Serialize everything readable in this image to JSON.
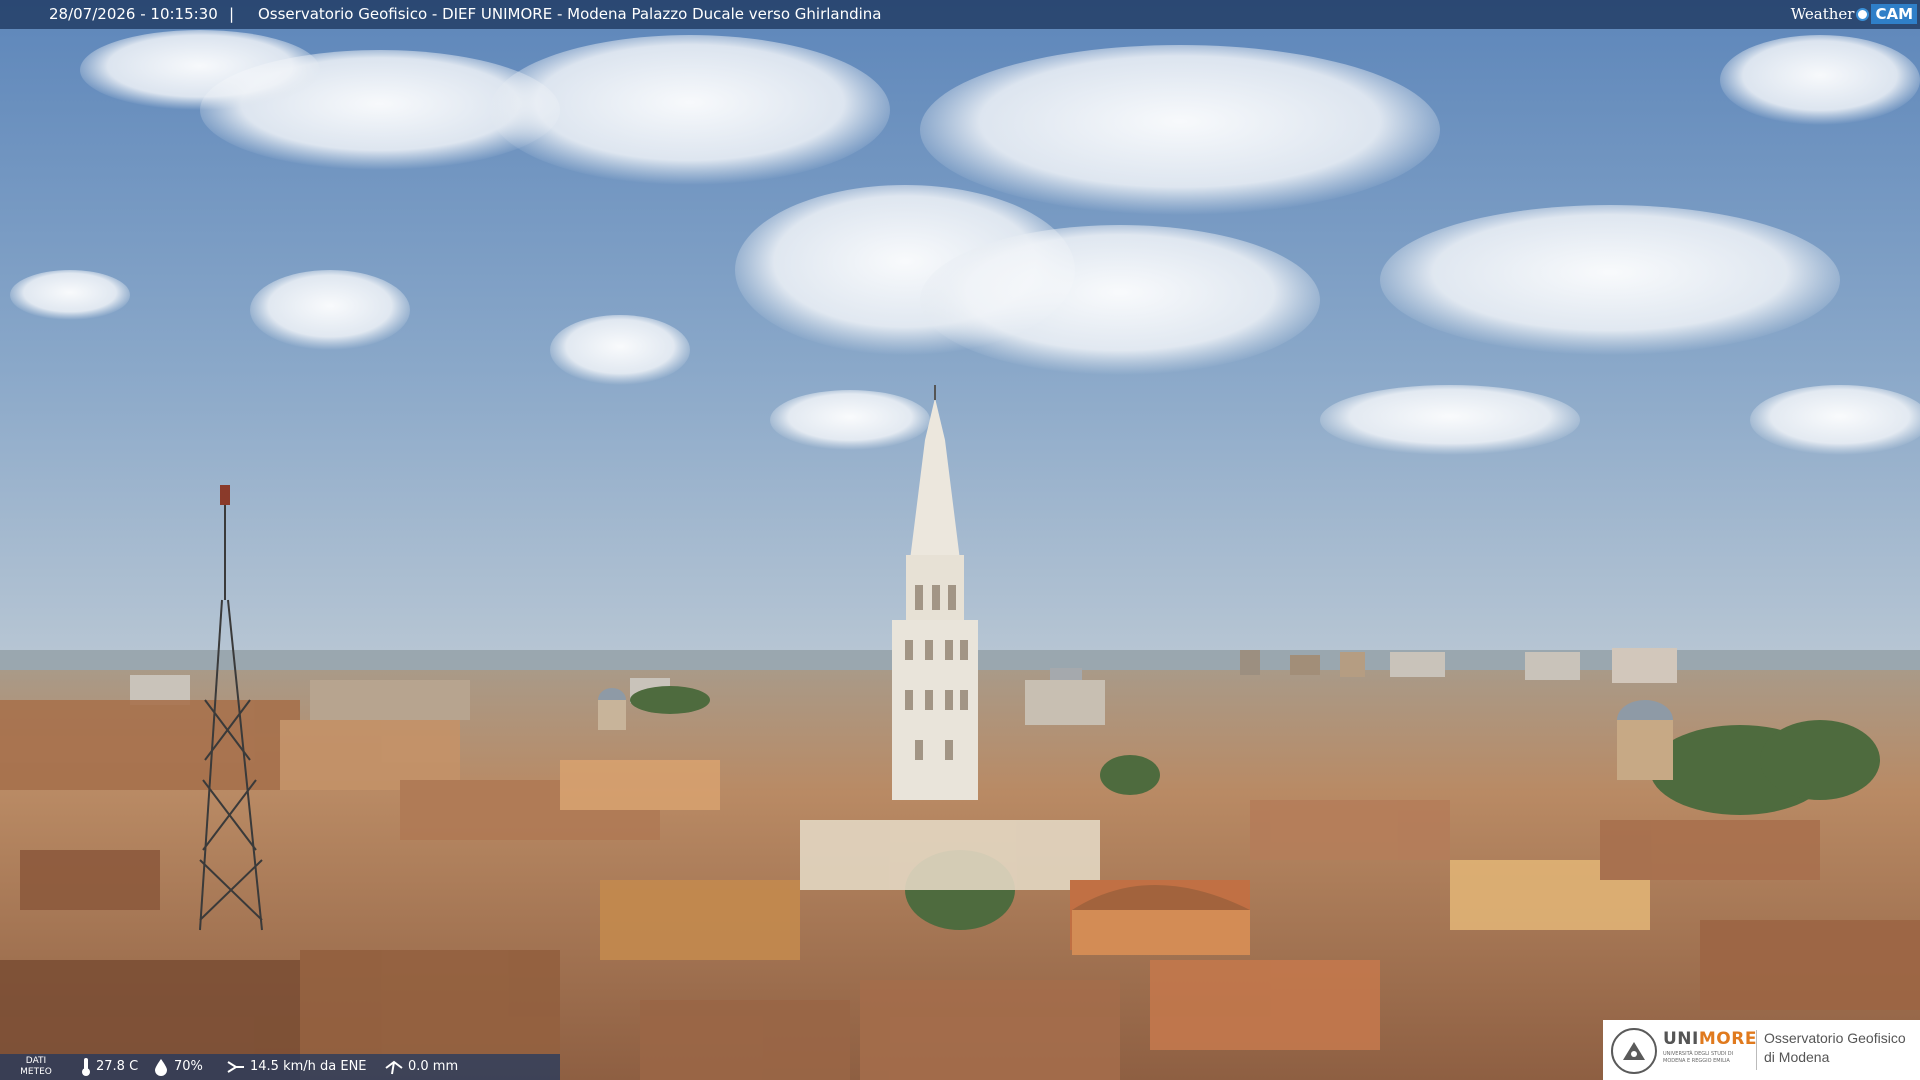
{
  "header": {
    "datetime": "28/07/2026 - 10:15:30",
    "separator": "|",
    "title": "Osservatorio Geofisico - DIEF UNIMORE - Modena Palazzo Ducale verso Ghirlandina",
    "brand_weather": "Weather",
    "brand_cam": "CAM"
  },
  "meteo": {
    "label_line1": "DATI",
    "label_line2": "METEO",
    "temperature": "27.8 C",
    "humidity": "70%",
    "wind": "14.5 km/h da ENE",
    "rain": "0.0 mm",
    "icons": [
      "thermometer-icon",
      "humidity-drop-icon",
      "wind-icon",
      "rain-gauge-icon"
    ]
  },
  "logo": {
    "uni": "UNI",
    "more": "MORE",
    "university_line1": "UNIVERSITÀ DEGLI STUDI DI",
    "university_line2": "MODENA E REGGIO EMILIA",
    "observatory_line1": "Osservatorio Geofisico",
    "observatory_line2": "di Modena"
  },
  "colors": {
    "sky_top": "#5d86ba",
    "sky_horizon": "#b4c5d5",
    "roofs": "#b98560",
    "tower_stone": "#e9e4da",
    "bar_bg": "#1e375f",
    "unimore_orange": "#e07a1e"
  }
}
